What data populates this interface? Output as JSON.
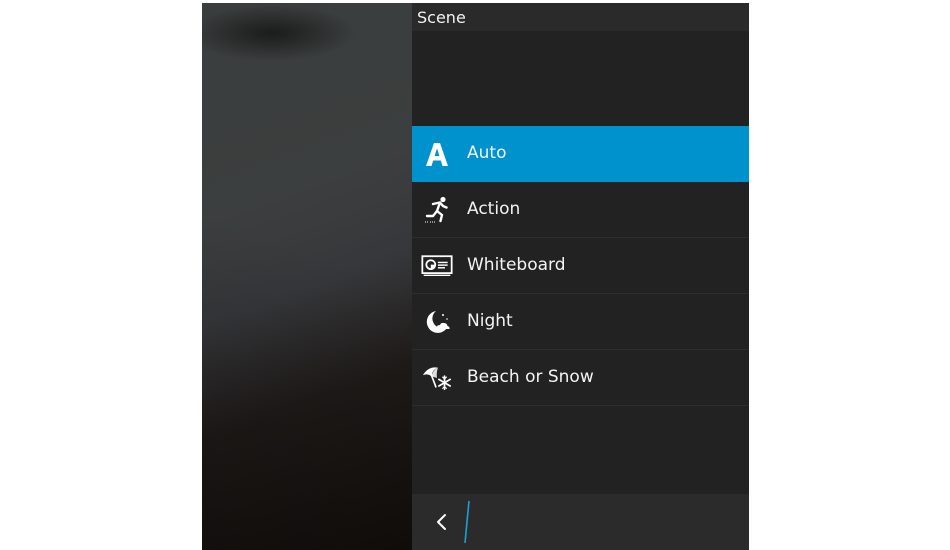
{
  "panel": {
    "title": "Scene"
  },
  "scenes": [
    {
      "label": "Auto",
      "icon": "letter-a-icon",
      "selected": true
    },
    {
      "label": "Action",
      "icon": "running-person-icon",
      "selected": false
    },
    {
      "label": "Whiteboard",
      "icon": "whiteboard-icon",
      "selected": false
    },
    {
      "label": "Night",
      "icon": "moon-icon",
      "selected": false
    },
    {
      "label": "Beach or Snow",
      "icon": "umbrella-snowflake-icon",
      "selected": false
    }
  ],
  "action_bar": {
    "back_icon": "chevron-left-icon"
  },
  "colors": {
    "accent": "#0092cc",
    "panel_bg": "#222222",
    "action_bar_bg": "#2b2b2b",
    "text": "#f4f4f4"
  }
}
